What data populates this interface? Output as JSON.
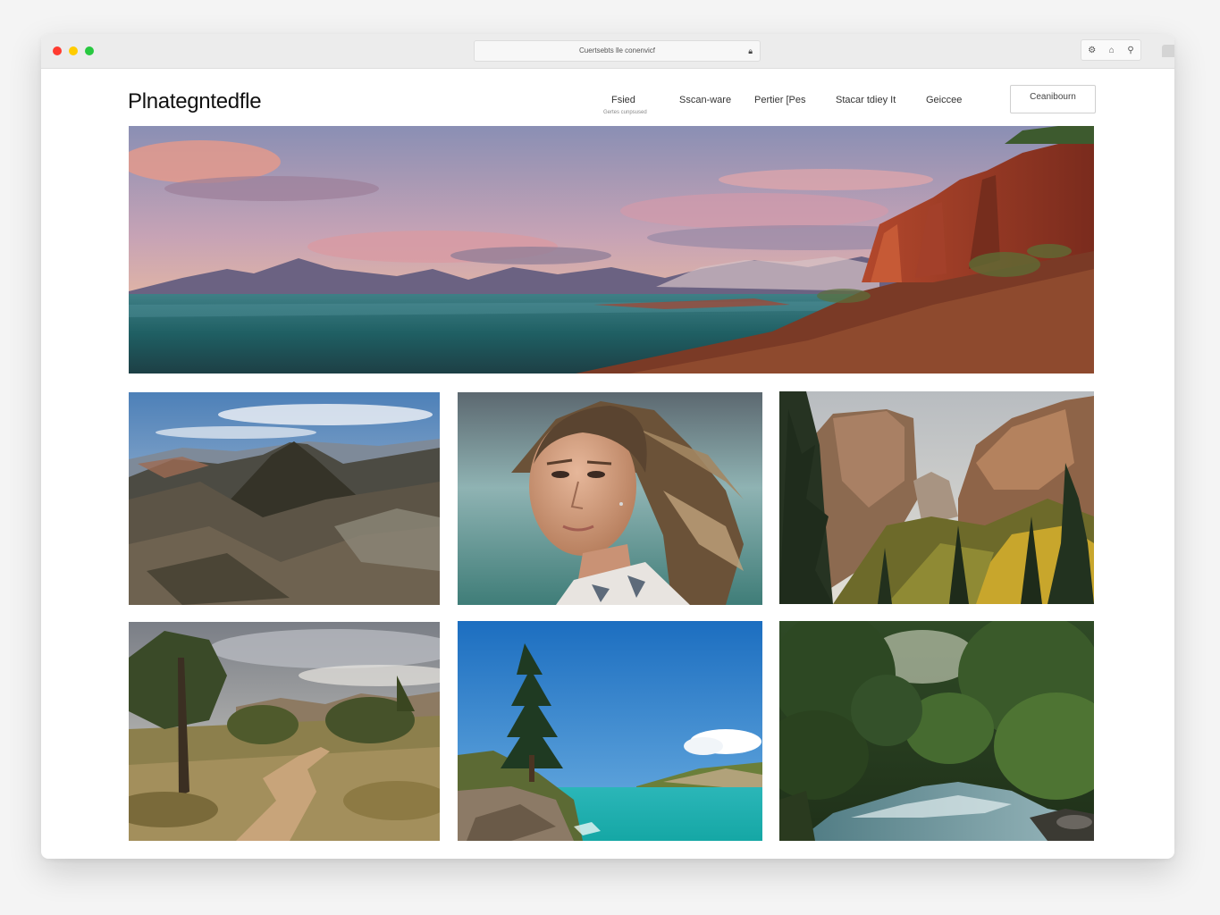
{
  "browser": {
    "url": "Cuertsebts lle conenvicf",
    "lock_icon": "lock-icon",
    "action_icons": [
      "extensions-icon",
      "bell-icon",
      "search-icon"
    ]
  },
  "site": {
    "brand": "Plnategntedfle",
    "nav": [
      {
        "label": "Fsied",
        "sublabel": "Gertes cunpsused"
      },
      {
        "label": "Sscan-ware"
      },
      {
        "label": "Pertier [Pes"
      },
      {
        "label": "Stacar tdiey It"
      },
      {
        "label": "Geiccee"
      }
    ],
    "cta_label": "Ceanibourn"
  },
  "gallery": {
    "hero": {
      "subject": "lake with mountains and red cliffs at sunset"
    },
    "photos": [
      {
        "subject": "aerial mountain ridges"
      },
      {
        "subject": "portrait of a woman with windswept hair"
      },
      {
        "subject": "canyon cliffs with pine forest"
      },
      {
        "subject": "dirt trail through trees"
      },
      {
        "subject": "pine tree above turquoise sea"
      },
      {
        "subject": "river through green forest"
      }
    ]
  }
}
